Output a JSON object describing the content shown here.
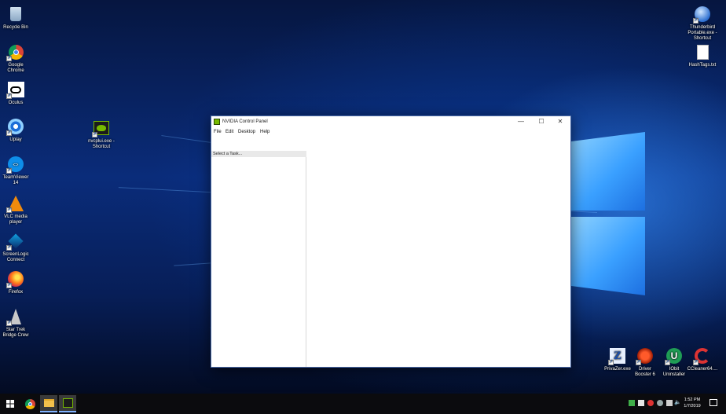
{
  "desktop": {
    "icons_left": [
      {
        "name": "recycle-bin",
        "label": "Recycle Bin",
        "shortcut": false
      },
      {
        "name": "google-chrome",
        "label": "Google\nChrome",
        "shortcut": true
      },
      {
        "name": "oculus",
        "label": "Oculus",
        "shortcut": true
      },
      {
        "name": "uplay",
        "label": "Uplay",
        "shortcut": true
      },
      {
        "name": "teamviewer-14",
        "label": "TeamViewer\n14",
        "shortcut": true
      },
      {
        "name": "vlc-media-player",
        "label": "VLC media\nplayer",
        "shortcut": true
      },
      {
        "name": "screenlogic-connect",
        "label": "ScreenLogic\nConnect",
        "shortcut": true
      },
      {
        "name": "firefox",
        "label": "Firefox",
        "shortcut": true
      },
      {
        "name": "star-trek-bridge-crew",
        "label": "Star Trek\nBridge Crew",
        "shortcut": true
      }
    ],
    "icon_nvcplui": {
      "label": "nvcplui.exe -\nShortcut"
    },
    "icons_right_top": [
      {
        "name": "thunderbird",
        "label": "Thunderbird\nPortable.exe -\nShortcut"
      },
      {
        "name": "hashtags",
        "label": "HashTags.txt"
      }
    ],
    "icons_bottom_right": [
      {
        "name": "privazer",
        "label": "PrivaZer.exe"
      },
      {
        "name": "driver-booster",
        "label": "Driver\nBooster 6"
      },
      {
        "name": "iobit-uninstaller",
        "label": "IObit\nUninstaller"
      },
      {
        "name": "ccleaner",
        "label": "CCleaner64...."
      }
    ]
  },
  "window": {
    "title": "NVIDIA Control Panel",
    "controls": {
      "minimize": "—",
      "maximize": "☐",
      "close": "✕"
    },
    "menu": [
      "File",
      "Edit",
      "Desktop",
      "Help"
    ],
    "task_header": "Select a Task..."
  },
  "taskbar": {
    "clock_time": "1:52 PM",
    "clock_date": "1/7/2019"
  },
  "colors": {
    "accent": "#7fb2ff",
    "nvidia_green": "#76b900",
    "taskbar": "#0b0b0e"
  }
}
